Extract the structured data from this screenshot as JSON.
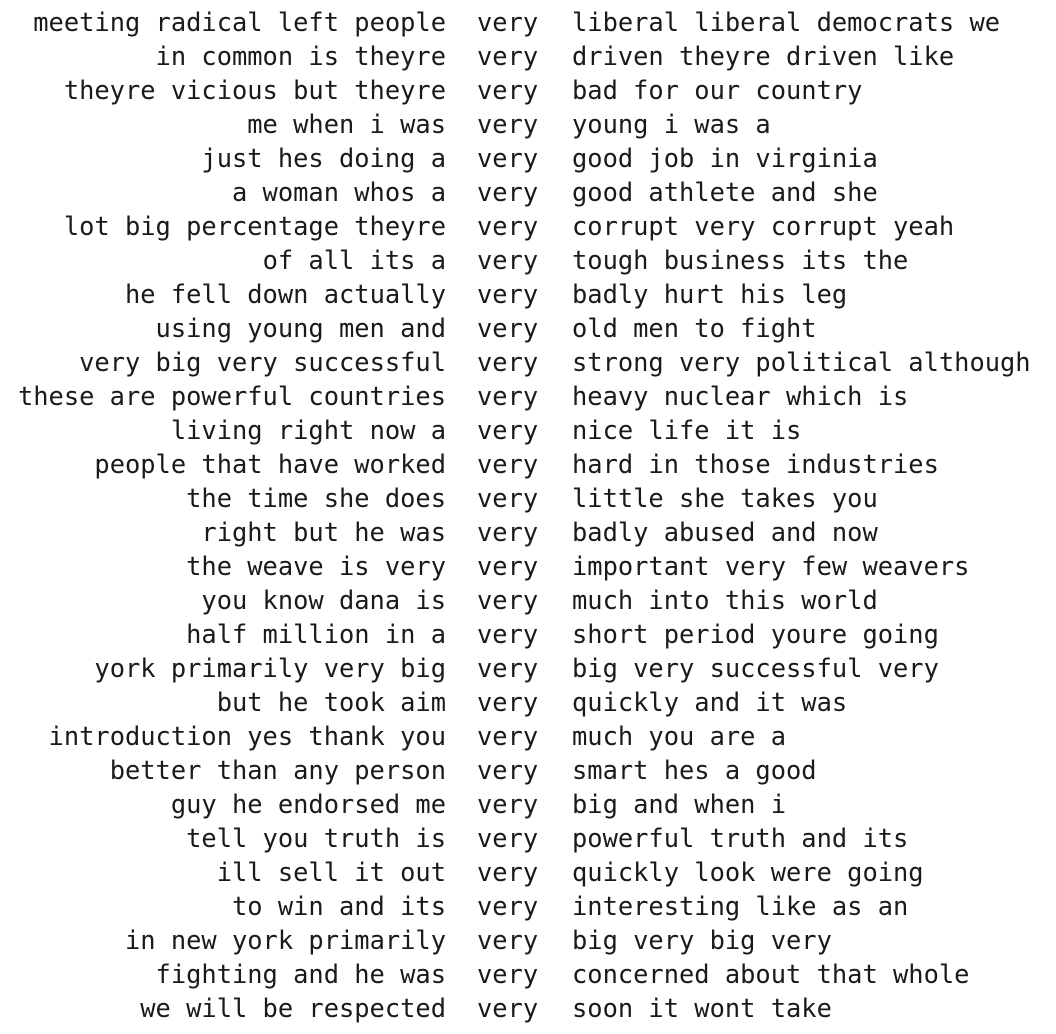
{
  "keyword": "very",
  "lines": [
    {
      "left": "meeting radical left people",
      "right": "liberal liberal democrats we"
    },
    {
      "left": "in common is theyre",
      "right": "driven theyre driven like"
    },
    {
      "left": "theyre vicious but theyre",
      "right": "bad for our country"
    },
    {
      "left": "me when i was",
      "right": "young i was a"
    },
    {
      "left": "just hes doing a",
      "right": "good job in virginia"
    },
    {
      "left": "a woman whos a",
      "right": "good athlete and she"
    },
    {
      "left": "lot big percentage theyre",
      "right": "corrupt very corrupt yeah"
    },
    {
      "left": "of all its a",
      "right": "tough business its the"
    },
    {
      "left": "he fell down actually",
      "right": "badly hurt his leg"
    },
    {
      "left": "using young men and",
      "right": "old men to fight"
    },
    {
      "left": "very big very successful",
      "right": "strong very political although"
    },
    {
      "left": "these are powerful countries",
      "right": "heavy nuclear which is"
    },
    {
      "left": "living right now a",
      "right": "nice life it is"
    },
    {
      "left": "people that have worked",
      "right": "hard in those industries"
    },
    {
      "left": "the time she does",
      "right": "little she takes you"
    },
    {
      "left": "right but he was",
      "right": "badly abused and now"
    },
    {
      "left": "the weave is very",
      "right": "important very few weavers"
    },
    {
      "left": "you know dana is",
      "right": "much into this world"
    },
    {
      "left": "half million in a",
      "right": "short period youre going"
    },
    {
      "left": "york primarily very big",
      "right": "big very successful very"
    },
    {
      "left": "but he took aim",
      "right": "quickly and it was"
    },
    {
      "left": "introduction yes thank you",
      "right": "much you are a"
    },
    {
      "left": "better than any person",
      "right": "smart hes a good"
    },
    {
      "left": "guy he endorsed me",
      "right": "big and when i"
    },
    {
      "left": "tell you truth is",
      "right": "powerful truth and its"
    },
    {
      "left": "ill sell it out",
      "right": "quickly look were going"
    },
    {
      "left": "to win and its",
      "right": "interesting like as an"
    },
    {
      "left": "in new york primarily",
      "right": "big very big very"
    },
    {
      "left": "fighting and he was",
      "right": "concerned about that whole"
    },
    {
      "left": "we will be respected",
      "right": "soon it wont take"
    }
  ]
}
